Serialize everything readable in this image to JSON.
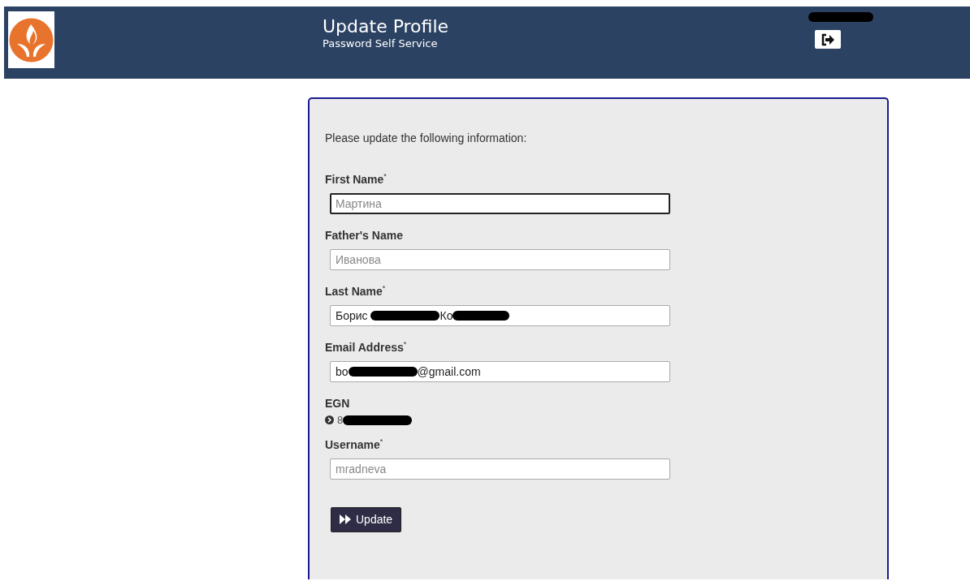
{
  "header": {
    "title": "Update Profile",
    "subtitle": "Password Self Service",
    "user_redacted": true
  },
  "form": {
    "intro": "Please update the following information:",
    "fields": [
      {
        "kind": "input",
        "label": "First Name",
        "required_mark": "*",
        "focused": true,
        "placeholder": "Мартина"
      },
      {
        "kind": "input",
        "label": "Father's Name",
        "focused": false,
        "placeholder": "Иванова"
      },
      {
        "kind": "input",
        "label": "Last Name",
        "required_mark": "*",
        "focused": false,
        "value_parts": [
          {
            "text": "Борис "
          },
          {
            "kind": "redacted"
          },
          {
            "text": "Ко"
          },
          {
            "kind": "redacted"
          }
        ]
      },
      {
        "kind": "input",
        "label": "Email Address",
        "required_mark": "*",
        "focused": false,
        "value_parts": [
          {
            "text": "bo"
          },
          {
            "kind": "redacted"
          },
          {
            "text": "@gmail.com"
          }
        ]
      },
      {
        "kind": "readonly",
        "label": "EGN",
        "value_parts": [
          {
            "text": "8"
          },
          {
            "kind": "redacted"
          }
        ]
      },
      {
        "kind": "input",
        "label": "Username",
        "required_mark": "*",
        "focused": false,
        "placeholder": "mradneva"
      }
    ],
    "submit": "Update"
  }
}
